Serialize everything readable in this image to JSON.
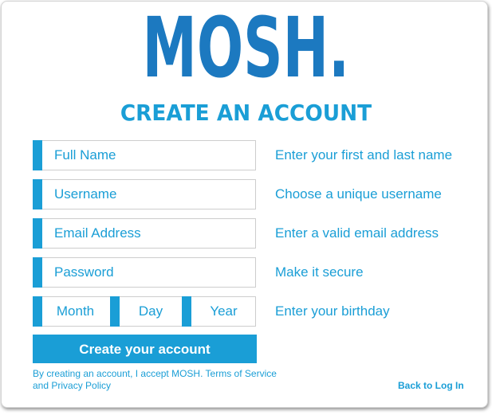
{
  "logo": {
    "text": "MOSH."
  },
  "title": "CREATE AN ACCOUNT",
  "fields": [
    {
      "placeholder": "Full Name",
      "hint": "Enter your first and last name"
    },
    {
      "placeholder": "Username",
      "hint": "Choose a unique username"
    },
    {
      "placeholder": "Email Address",
      "hint": "Enter a valid email address"
    },
    {
      "placeholder": "Password",
      "hint": "Make it secure"
    }
  ],
  "birthday": {
    "month": "Month",
    "day": "Day",
    "year": "Year",
    "hint": "Enter your birthday"
  },
  "submit_label": "Create your account",
  "terms_text": "By creating an account, I accept MOSH. Terms of Service and Privacy Policy",
  "back_link": "Back to Log In",
  "colors": {
    "brand_dark": "#1c79c0",
    "accent": "#1a9ed6",
    "border": "#cdcdcd"
  }
}
